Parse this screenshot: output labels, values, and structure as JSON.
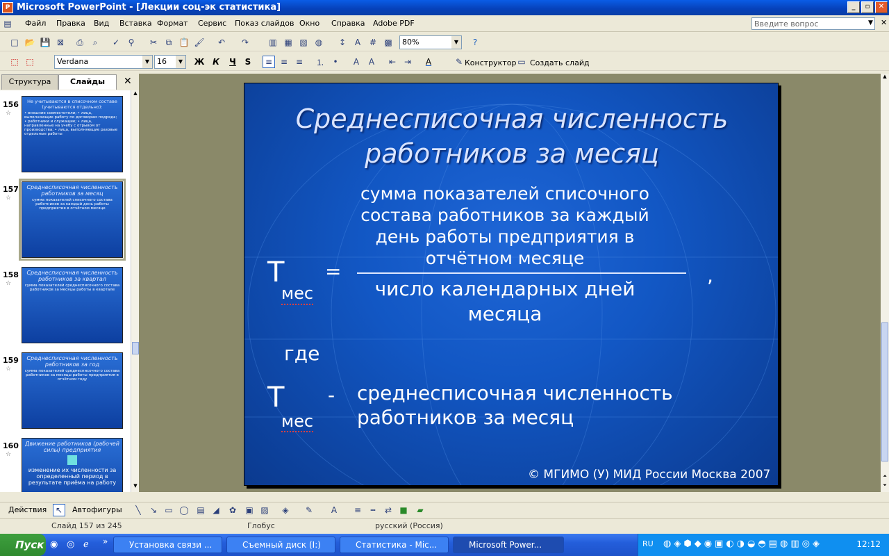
{
  "window": {
    "title": "Microsoft PowerPoint - [Лекции соц-эк статистика]"
  },
  "menu": [
    "Файл",
    "Правка",
    "Вид",
    "Вставка",
    "Формат",
    "Сервис",
    "Показ слайдов",
    "Окно",
    "Справка",
    "Adobe PDF"
  ],
  "ask_placeholder": "Введите вопрос",
  "toolbar": {
    "zoom": "80%",
    "font": "Verdana",
    "size": "16",
    "designer": "Конструктор",
    "new_slide": "Создать слайд"
  },
  "panel": {
    "tab_outline": "Структура",
    "tab_slides": "Слайды"
  },
  "thumbs": [
    {
      "num": "156",
      "title": "Не учитываются в списочном составе (учитываются отдельно):",
      "body": "• внешние совместители; • лица, выполняющие работу по договорам подряда; • работники и служащие; • лица, направленные на учебу с отрывом от производства; • лица, выполняющие разовые отдельные работы"
    },
    {
      "num": "157",
      "title": "Среднесписочная численность работников за месяц",
      "body": "сумма показателей списочного состава работников за каждый день работы предприятия в отчётном месяце"
    },
    {
      "num": "158",
      "title": "Среднесписочная численность работников за квартал",
      "body": "сумма показателей среднесписочного состава работников за месяцы работы в квартале"
    },
    {
      "num": "159",
      "title": "Среднесписочная численность работников за год",
      "body": "сумма показателей среднесписочного состава работников за месяцы работы предприятия в отчётном году"
    },
    {
      "num": "160",
      "title": "Движение работников (рабочей силы) предприятия",
      "body": "изменение их численности за определенный период в результате приёма на работу"
    }
  ],
  "slide": {
    "title": "Среднесписочная численность работников за месяц",
    "T": "Т",
    "sub": "мес",
    "eq": "=",
    "comma": ",",
    "dash": "-",
    "numerator": "сумма показателей списочного состава работников за каждый день работы предприятия в отчётном месяце",
    "denominator": "число календарных дней месяца",
    "where": "где",
    "desc": "среднесписочная численность работников за месяц",
    "copyright": "© МГИМО (У) МИД России Москва 2007"
  },
  "draw": {
    "actions": "Действия",
    "autoshapes": "Автофигуры"
  },
  "status": {
    "slide": "Слайд 157 из 245",
    "design": "Глобус",
    "lang": "русский (Россия)"
  },
  "taskbar": {
    "start": "Пуск",
    "tasks": [
      "Установка связи ...",
      "Съемный диск (I:)",
      "Статистика - Mic...",
      "Microsoft Power..."
    ],
    "lang": "RU",
    "clock": "12:12"
  }
}
